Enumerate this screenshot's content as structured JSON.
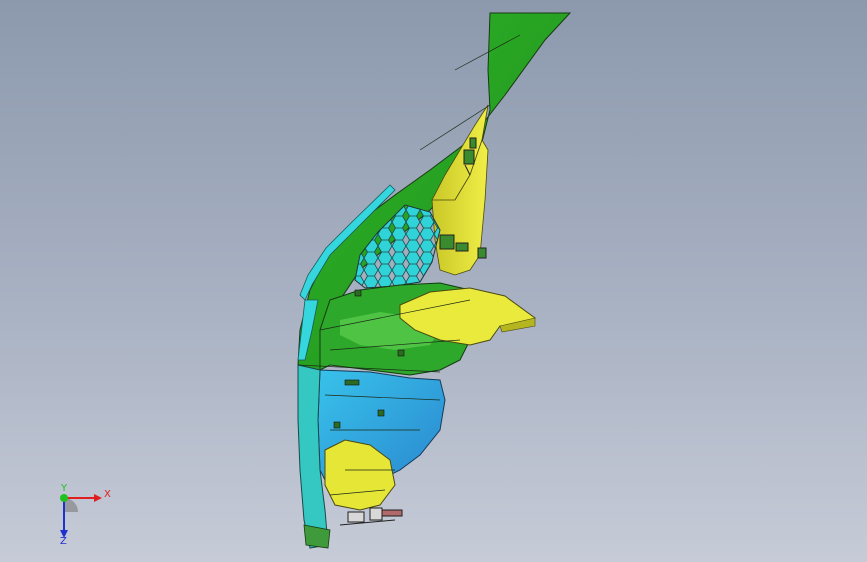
{
  "viewport": {
    "background_top": "#8c99ad",
    "background_bottom": "#c6cbd7"
  },
  "model": {
    "part_colors": {
      "green": "#33bb2a",
      "dark_green": "#1d7f16",
      "yellow": "#e2e63a",
      "cyan": "#36d6de",
      "blue": "#3aa6e6",
      "edge": "#1a2a16"
    }
  },
  "triad": {
    "x_label": "X",
    "y_label": "Y",
    "z_label": "Z",
    "x_color": "#e02020",
    "y_color": "#20c020",
    "z_color": "#2030d0"
  }
}
